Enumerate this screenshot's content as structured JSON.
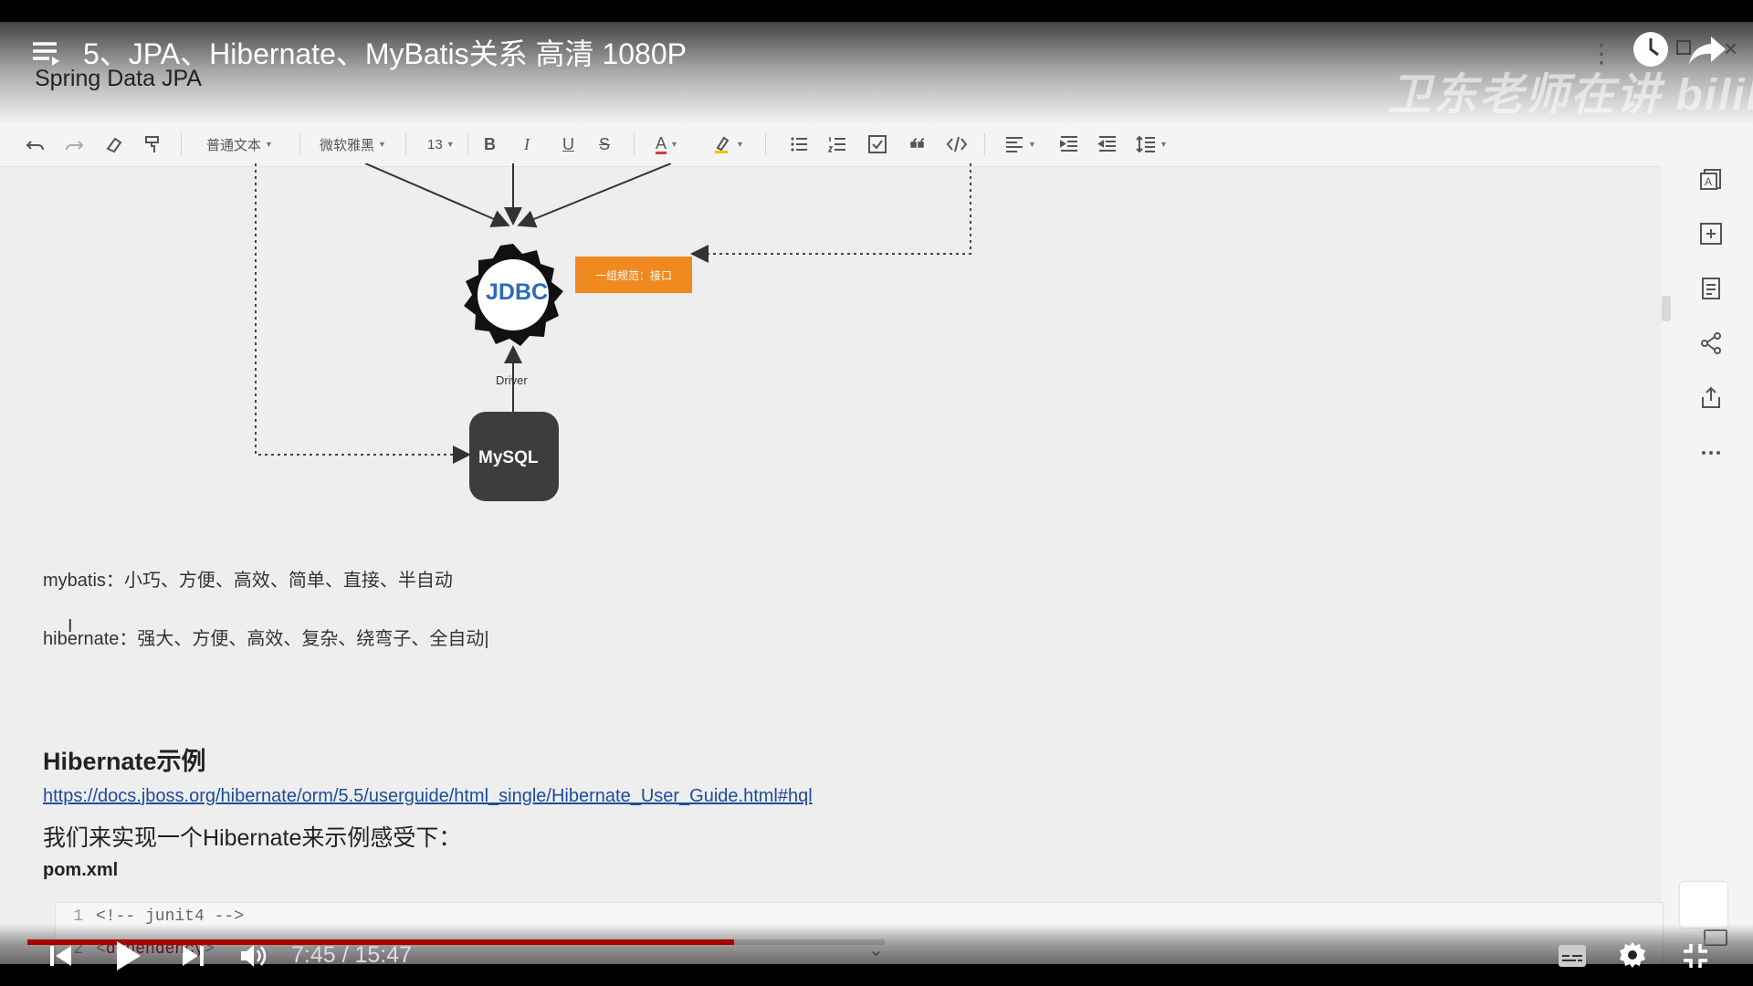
{
  "player": {
    "title": "5、JPA、Hibernate、MyBatis关系 高清 1080P",
    "channel": "Spring Data JPA",
    "watermark": "卫东老师在讲 bilibili",
    "time_display": "7:45 / 15:47",
    "progress_played": 0.416,
    "progress_buffered": 0.505,
    "icons": [
      "playlist-icon",
      "clock-icon",
      "share-icon",
      "close-icon",
      "prev-icon",
      "play-icon",
      "next-icon",
      "volume-icon",
      "subtitles-icon",
      "settings-icon",
      "exit-fullscreen-icon"
    ]
  },
  "toolbar": {
    "paragraph_style": "普通文本",
    "font_family": "微软雅黑",
    "font_size": "13",
    "bold": "B",
    "italic": "I",
    "underline": "U",
    "strike": "S",
    "font_color": "A"
  },
  "diagram": {
    "jdbc": "JDBC",
    "jdbc_tag": "一组规范：接口",
    "driver": "Driver",
    "mysql": "MySQL"
  },
  "document": {
    "mybatis_line": "mybatis：小巧、方便、高效、简单、直接、半自动",
    "hibernate_line": "hibernate：强大、方便、高效、复杂、绕弯子、全自动",
    "section_title": "Hibernate示例",
    "link": "https://docs.jboss.org/hibernate/orm/5.5/userguide/html_single/Hibernate_User_Guide.html#hql",
    "intro": "我们来实现一个Hibernate来示例感受下：",
    "file_label": "pom.xml",
    "code": [
      {
        "num": "1",
        "text": "<!-- junit4 -->"
      },
      {
        "num": "2",
        "text": "dependency"
      }
    ]
  },
  "colors": {
    "progress": "#ff0000",
    "jdbc_text": "#2b6bb6",
    "tag_orange": "#f08a20",
    "link": "#1c4c9c"
  }
}
